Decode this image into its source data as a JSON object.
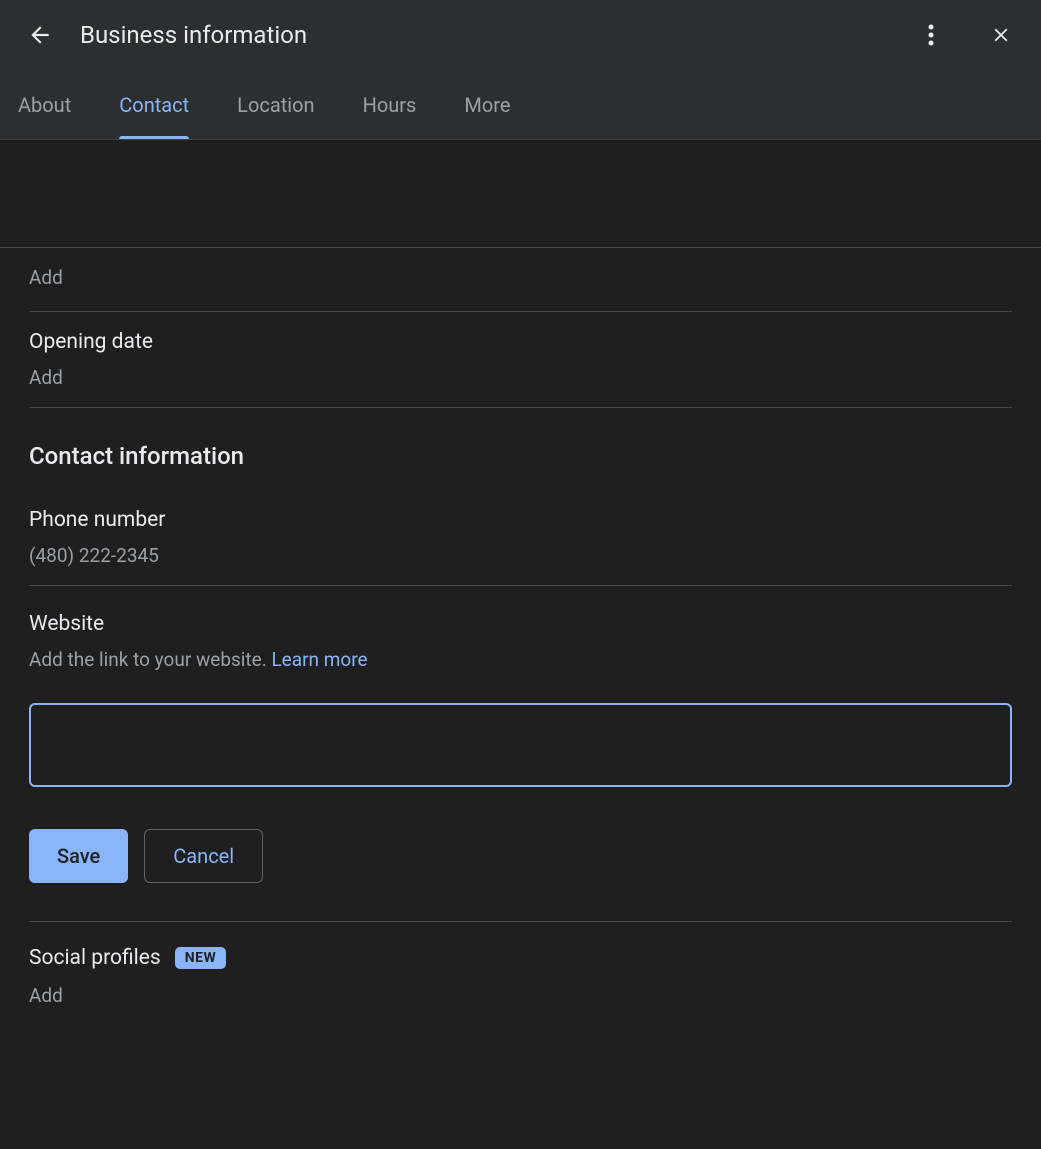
{
  "header": {
    "title": "Business information"
  },
  "tabs": {
    "items": [
      {
        "label": "About"
      },
      {
        "label": "Contact"
      },
      {
        "label": "Location"
      },
      {
        "label": "Hours"
      },
      {
        "label": "More"
      }
    ],
    "activeIndex": 1
  },
  "content": {
    "topAdd": "Add",
    "openingDate": {
      "title": "Opening date",
      "value": "Add"
    },
    "contactInfo": {
      "heading": "Contact information",
      "phone": {
        "title": "Phone number",
        "value": "(480) 222-2345"
      },
      "website": {
        "title": "Website",
        "desc": "Add the link to your website. ",
        "learnMore": "Learn more",
        "value": ""
      }
    },
    "buttons": {
      "save": "Save",
      "cancel": "Cancel"
    },
    "social": {
      "title": "Social profiles",
      "badge": "NEW",
      "value": "Add"
    }
  }
}
